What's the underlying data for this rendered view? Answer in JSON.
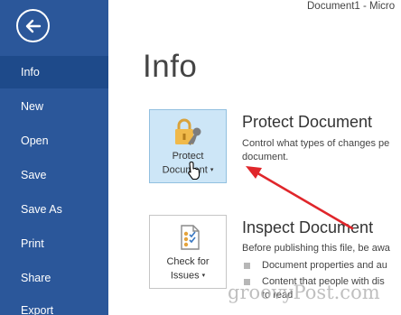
{
  "window": {
    "title": "Document1 - Micro"
  },
  "sidebar": {
    "items": [
      {
        "label": "Info",
        "active": true
      },
      {
        "label": "New"
      },
      {
        "label": "Open"
      },
      {
        "label": "Save"
      },
      {
        "label": "Save As"
      },
      {
        "label": "Print"
      },
      {
        "label": "Share"
      },
      {
        "label": "Export"
      }
    ]
  },
  "main": {
    "title": "Info",
    "protect": {
      "button_line1": "Protect",
      "button_line2": "Document",
      "caret": "▾",
      "heading": "Protect Document",
      "description": "Control what types of changes pe document."
    },
    "inspect": {
      "button_line1": "Check for",
      "button_line2": "Issues",
      "caret": "▾",
      "heading": "Inspect Document",
      "description": "Before publishing this file, be awa",
      "bullets": [
        "Document properties and au",
        "Content that people with dis",
        "to read"
      ]
    }
  },
  "watermark": "groovyPost.com",
  "colors": {
    "sidebar": "#2b579a",
    "sidebar_active": "#1e4a8a",
    "selected_tile": "#cde6f7",
    "arrow": "#e0262b"
  }
}
